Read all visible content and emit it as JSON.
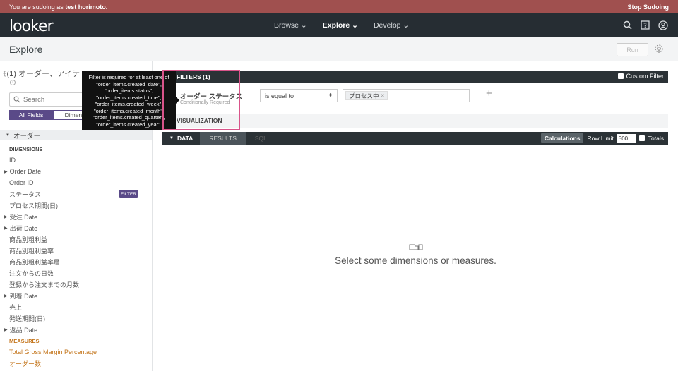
{
  "sudo": {
    "prefix": "You are sudoing as",
    "user": "test horimoto.",
    "stop_label": "Stop Sudoing"
  },
  "nav": {
    "logo": "looker",
    "items": [
      {
        "label": "Browse ⌄",
        "active": false
      },
      {
        "label": "Explore ⌄",
        "active": true
      },
      {
        "label": "Develop ⌄",
        "active": false
      }
    ],
    "icons": [
      "search-icon",
      "help-icon",
      "user-icon"
    ]
  },
  "page": {
    "title": "Explore",
    "run_label": "Run"
  },
  "sidebar": {
    "title": "(1) オーダー、アイテ",
    "search_placeholder": "Search",
    "tabs": [
      "All Fields",
      "Dimens"
    ],
    "view_name": "オーダー",
    "fields": [
      {
        "label": "DIMENSIONS",
        "kind": "section"
      },
      {
        "label": "ID",
        "kind": "field"
      },
      {
        "label": "Order Date",
        "kind": "group"
      },
      {
        "label": "Order ID",
        "kind": "field"
      },
      {
        "label": "ステータス",
        "kind": "field",
        "badge": "FILTER"
      },
      {
        "label": "プロセス期間(日)",
        "kind": "field"
      },
      {
        "label": "受注 Date",
        "kind": "group"
      },
      {
        "label": "出荷 Date",
        "kind": "group"
      },
      {
        "label": "商品別粗利益",
        "kind": "field"
      },
      {
        "label": "商品別粗利益率",
        "kind": "field"
      },
      {
        "label": "商品別粗利益率層",
        "kind": "field"
      },
      {
        "label": "注文からの日数",
        "kind": "field"
      },
      {
        "label": "登録から注文までの月数",
        "kind": "field"
      },
      {
        "label": "到着 Date",
        "kind": "group"
      },
      {
        "label": "売上",
        "kind": "field"
      },
      {
        "label": "発送期間(日)",
        "kind": "field"
      },
      {
        "label": "返品 Date",
        "kind": "group"
      },
      {
        "label": "MEASURES",
        "kind": "section-measures"
      },
      {
        "label": "Total Gross Margin Percentage",
        "kind": "measure"
      },
      {
        "label": "オーダー数",
        "kind": "measure"
      }
    ]
  },
  "filters": {
    "header": "FILTERS (1)",
    "custom_filter_label": "Custom Filter",
    "row": {
      "field": "オーダー ステータス",
      "note": "Conditionally Required",
      "operator": "is equal to",
      "value": "プロセス中"
    }
  },
  "visualization": {
    "label": "VISUALIZATION"
  },
  "data": {
    "tab_data": "DATA",
    "tab_results": "RESULTS",
    "tab_sql": "SQL",
    "calc_label": "Calculations",
    "row_limit_label": "Row Limit",
    "row_limit_value": "500",
    "totals_label": "Totals"
  },
  "empty": {
    "message": "Select some dimensions or measures."
  },
  "tooltip": {
    "lines": [
      "Filter is required for at least one of",
      "\"order_items.created_date\",",
      "\"order_items.status\",",
      "\"order_items.created_time\",",
      "\"order_items.created_week\",",
      "\"order_items.created_month\",",
      "\"order_items.created_quarter\",",
      "\"order_items.created_year\"."
    ]
  }
}
